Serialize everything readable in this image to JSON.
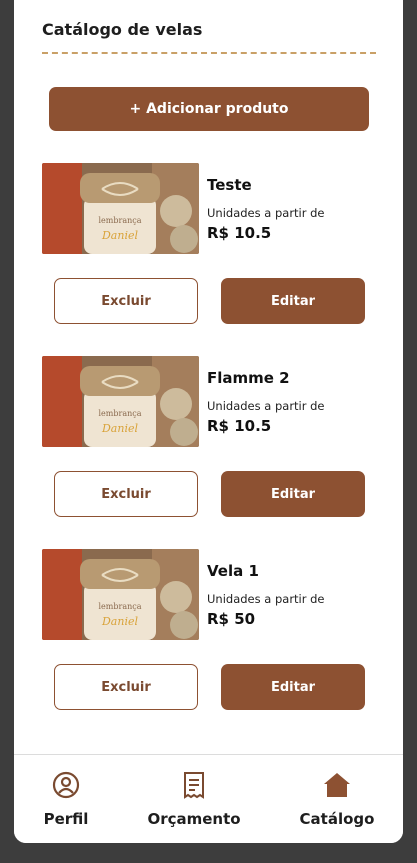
{
  "header": {
    "title": "Catálogo de velas"
  },
  "actions": {
    "add_label": "+ Adicionar produto"
  },
  "products": [
    {
      "name": "Teste",
      "unit_label": "Unidades a partir de",
      "price": "R$ 10.5",
      "delete_label": "Excluir",
      "edit_label": "Editar"
    },
    {
      "name": "Flamme 2",
      "unit_label": "Unidades a partir de",
      "price": "R$ 10.5",
      "delete_label": "Excluir",
      "edit_label": "Editar"
    },
    {
      "name": "Vela 1",
      "unit_label": "Unidades a partir de",
      "price": "R$ 50",
      "delete_label": "Excluir",
      "edit_label": "Editar"
    }
  ],
  "nav": {
    "items": [
      {
        "label": "Perfil",
        "icon": "profile-icon"
      },
      {
        "label": "Orçamento",
        "icon": "receipt-icon"
      },
      {
        "label": "Catálogo",
        "icon": "home-icon",
        "active": true
      }
    ]
  },
  "colors": {
    "accent": "#8d5132",
    "divider": "#c9a067",
    "background": "#3d3d3d"
  }
}
